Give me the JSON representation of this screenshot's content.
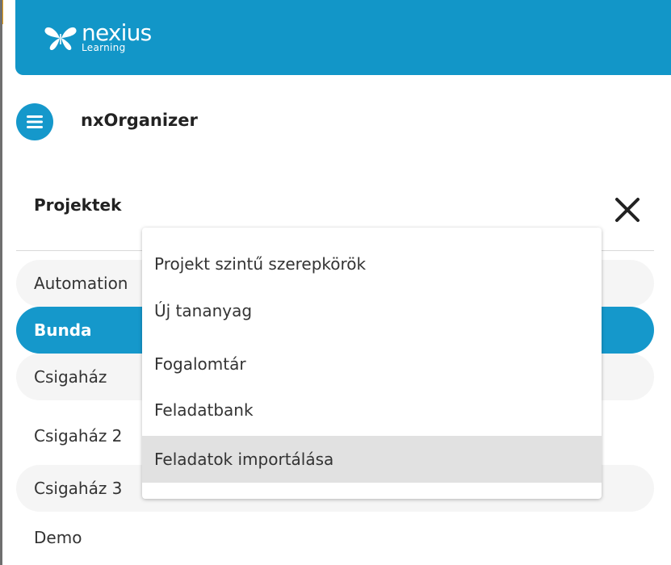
{
  "brand": {
    "name": "nexius",
    "tagline": "Learning"
  },
  "app": {
    "title": "nxOrganizer",
    "menu_icon": "hamburger-menu-icon"
  },
  "panel": {
    "title": "Projektek",
    "close_icon": "close-icon"
  },
  "projects": [
    {
      "label": "Automation"
    },
    {
      "label": "Bunda",
      "selected": true
    },
    {
      "label": "Csigaház"
    },
    {
      "label": "Csigaház 2"
    },
    {
      "label": "Csigaház 3"
    },
    {
      "label": "Demo"
    }
  ],
  "context_menu": {
    "items": [
      {
        "label": "Projekt szintű szerepkörök"
      },
      {
        "label": "Új tananyag"
      },
      {
        "label": "Fogalomtár"
      },
      {
        "label": "Feladatbank"
      },
      {
        "label": "Feladatok importálása",
        "highlighted": true
      }
    ]
  },
  "colors": {
    "brand_blue": "#1598cb",
    "menu_highlight": "#e1e1e1",
    "row_alt": "#f5f5f5",
    "accent_mark": "#f2a416"
  }
}
